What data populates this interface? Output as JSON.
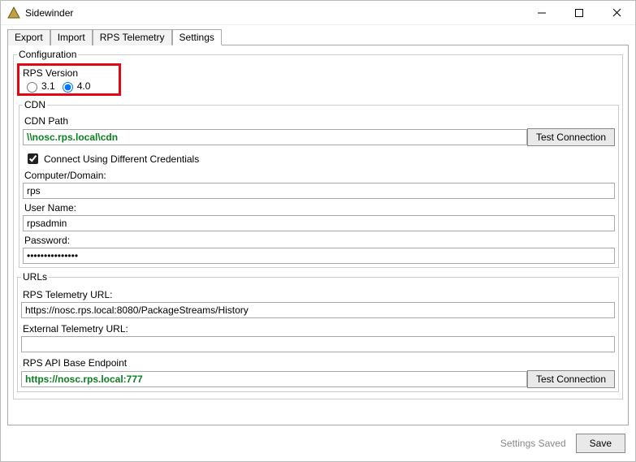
{
  "window": {
    "title": "Sidewinder"
  },
  "tabs": {
    "export": "Export",
    "import": "Import",
    "rps_telemetry": "RPS Telemetry",
    "settings": "Settings"
  },
  "config": {
    "legend": "Configuration",
    "rps_version_label": "RPS Version",
    "rps_version_options": {
      "v31": "3.1",
      "v40": "4.0"
    },
    "rps_version_selected": "4.0"
  },
  "cdn": {
    "legend": "CDN",
    "path_label": "CDN Path",
    "path_value": "\\\\nosc.rps.local\\cdn",
    "test_connection": "Test Connection",
    "connect_diff_creds_label": "Connect Using Different Credentials",
    "connect_diff_creds_checked": true,
    "computer_domain_label": "Computer/Domain:",
    "computer_domain_value": "rps",
    "username_label": "User Name:",
    "username_value": "rpsadmin",
    "password_label": "Password:",
    "password_value": "•••••••••••••••"
  },
  "urls": {
    "legend": "URLs",
    "telemetry_label": "RPS Telemetry URL:",
    "telemetry_value": "https://nosc.rps.local:8080/PackageStreams/History",
    "external_label": "External Telemetry URL:",
    "external_value": "",
    "api_label": "RPS API Base Endpoint",
    "api_value": "https://nosc.rps.local:777",
    "test_connection": "Test Connection"
  },
  "footer": {
    "status": "Settings Saved",
    "save": "Save"
  }
}
